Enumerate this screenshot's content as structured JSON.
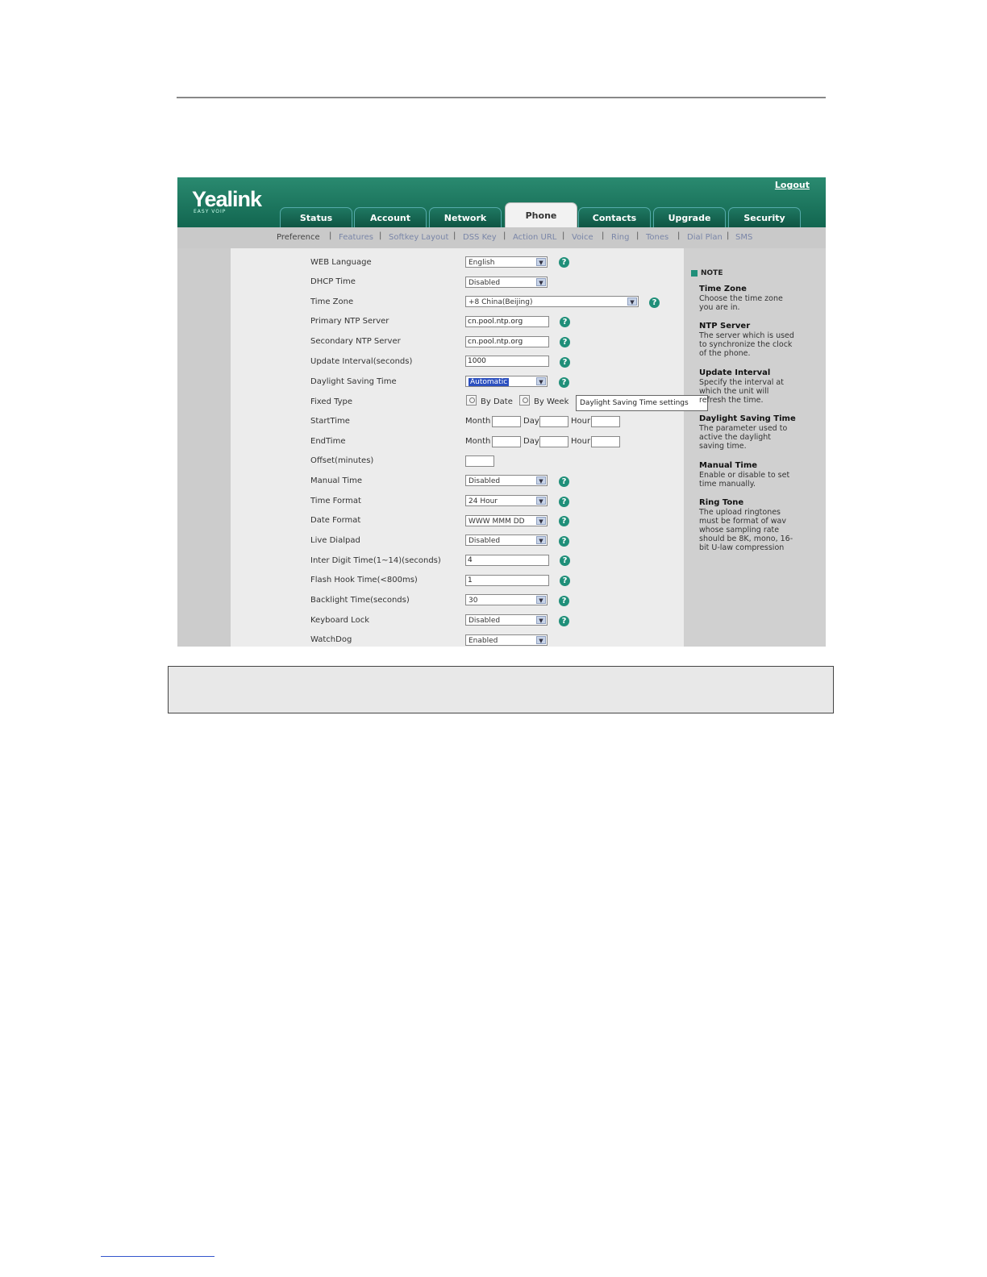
{
  "app": {
    "logo": "Yealink",
    "logo_sub": "EASY VOIP",
    "logout": "Logout"
  },
  "tabs": [
    "Status",
    "Account",
    "Network",
    "Phone",
    "Contacts",
    "Upgrade",
    "Security"
  ],
  "active_tab": "Phone",
  "subnav": [
    "Preference",
    "Features",
    "Softkey Layout",
    "DSS Key",
    "Action URL",
    "Voice",
    "Ring",
    "Tones",
    "Dial Plan",
    "SMS"
  ],
  "active_subnav": "Preference",
  "settings": {
    "web_language": {
      "label": "WEB Language",
      "value": "English"
    },
    "dhcp_time": {
      "label": "DHCP Time",
      "value": "Disabled"
    },
    "time_zone": {
      "label": "Time Zone",
      "value": "+8 China(Beijing)"
    },
    "primary_ntp": {
      "label": "Primary NTP Server",
      "value": "cn.pool.ntp.org"
    },
    "secondary_ntp": {
      "label": "Secondary NTP Server",
      "value": "cn.pool.ntp.org"
    },
    "update_interval": {
      "label": "Update Interval(seconds)",
      "value": "1000"
    },
    "daylight_saving": {
      "label": "Daylight Saving Time",
      "value": "Automatic"
    },
    "fixed_type": {
      "label": "Fixed Type",
      "by_date": "By Date",
      "by_week": "By Week"
    },
    "start_time": {
      "label": "StartTime",
      "month": "Month",
      "day": "Day",
      "hour": "Hour"
    },
    "end_time": {
      "label": "EndTime",
      "month": "Month",
      "day": "Day",
      "hour": "Hour"
    },
    "offset": {
      "label": "Offset(minutes)",
      "value": ""
    },
    "manual_time": {
      "label": "Manual Time",
      "value": "Disabled"
    },
    "time_format": {
      "label": "Time Format",
      "value": "24 Hour"
    },
    "date_format": {
      "label": "Date Format",
      "value": "WWW MMM DD"
    },
    "live_dialpad": {
      "label": "Live Dialpad",
      "value": "Disabled"
    },
    "inter_digit": {
      "label": "Inter Digit Time(1~14)(seconds)",
      "value": "4"
    },
    "flash_hook": {
      "label": "Flash Hook Time(<800ms)",
      "value": "1"
    },
    "backlight": {
      "label": "Backlight Time(seconds)",
      "value": "30"
    },
    "keyboard_lock": {
      "label": "Keyboard Lock",
      "value": "Disabled"
    },
    "watchdog": {
      "label": "WatchDog",
      "value": "Enabled"
    }
  },
  "tooltip": "Daylight Saving Time settings",
  "note": {
    "header": "NOTE",
    "items": [
      {
        "title": "Time Zone",
        "text": "Choose the time zone you are in."
      },
      {
        "title": "NTP Server",
        "text": "The server which is used to synchronize the clock of the phone."
      },
      {
        "title": "Update Interval",
        "text": "Specify the interval at which the unit will refresh the time."
      },
      {
        "title": "Daylight Saving Time",
        "text": "The parameter used to active the daylight saving time."
      },
      {
        "title": "Manual Time",
        "text": "Enable or disable to set time manually."
      },
      {
        "title": "Ring Tone",
        "text": "The upload ringtones must be format of wav whose sampling rate should be 8K, mono, 16-bit U-law compression"
      }
    ]
  },
  "icons": {
    "help": "question-mark-icon",
    "dropdown": "chevron-down-icon"
  },
  "help_glyph": "?",
  "arrow_glyph": "▼",
  "colors": {
    "brand": "#1f7862",
    "help": "#1f8f79"
  }
}
